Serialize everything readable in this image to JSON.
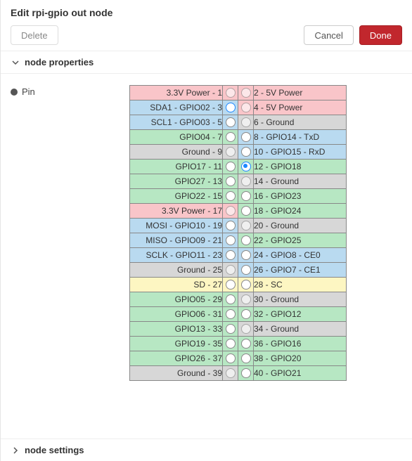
{
  "title": "Edit rpi-gpio out node",
  "buttons": {
    "delete": "Delete",
    "cancel": "Cancel",
    "done": "Done"
  },
  "sections": {
    "properties": "node properties",
    "settings": "node settings"
  },
  "pin_label": "Pin",
  "selected_pin": "12",
  "pins_left": [
    {
      "n": "1",
      "label": "3.3V Power - 1",
      "color": "c-power33",
      "selectable": false
    },
    {
      "n": "3",
      "label": "SDA1 - GPIO02 - 3",
      "color": "c-i2c",
      "selectable": true
    },
    {
      "n": "5",
      "label": "SCL1 - GPIO03 - 5",
      "color": "c-i2c",
      "selectable": true
    },
    {
      "n": "7",
      "label": "GPIO04 - 7",
      "color": "c-gpio",
      "selectable": true
    },
    {
      "n": "9",
      "label": "Ground - 9",
      "color": "c-ground",
      "selectable": false
    },
    {
      "n": "11",
      "label": "GPIO17 - 11",
      "color": "c-gpio",
      "selectable": true
    },
    {
      "n": "13",
      "label": "GPIO27 - 13",
      "color": "c-gpio",
      "selectable": true
    },
    {
      "n": "15",
      "label": "GPIO22 - 15",
      "color": "c-gpio",
      "selectable": true
    },
    {
      "n": "17",
      "label": "3.3V Power - 17",
      "color": "c-power33",
      "selectable": false
    },
    {
      "n": "19",
      "label": "MOSI - GPIO10 - 19",
      "color": "c-spi",
      "selectable": true
    },
    {
      "n": "21",
      "label": "MISO - GPIO09 - 21",
      "color": "c-spi",
      "selectable": true
    },
    {
      "n": "23",
      "label": "SCLK - GPIO11 - 23",
      "color": "c-spi",
      "selectable": true
    },
    {
      "n": "25",
      "label": "Ground - 25",
      "color": "c-ground",
      "selectable": false
    },
    {
      "n": "27",
      "label": "SD - 27",
      "color": "c-sd",
      "selectable": true
    },
    {
      "n": "29",
      "label": "GPIO05 - 29",
      "color": "c-gpio",
      "selectable": true
    },
    {
      "n": "31",
      "label": "GPIO06 - 31",
      "color": "c-gpio",
      "selectable": true
    },
    {
      "n": "33",
      "label": "GPIO13 - 33",
      "color": "c-gpio",
      "selectable": true
    },
    {
      "n": "35",
      "label": "GPIO19 - 35",
      "color": "c-gpio",
      "selectable": true
    },
    {
      "n": "37",
      "label": "GPIO26 - 37",
      "color": "c-gpio",
      "selectable": true
    },
    {
      "n": "39",
      "label": "Ground - 39",
      "color": "c-ground",
      "selectable": false
    }
  ],
  "pins_right": [
    {
      "n": "2",
      "label": "2 - 5V Power",
      "color": "c-power5",
      "selectable": false
    },
    {
      "n": "4",
      "label": "4 - 5V Power",
      "color": "c-power5",
      "selectable": false
    },
    {
      "n": "6",
      "label": "6 - Ground",
      "color": "c-ground",
      "selectable": false
    },
    {
      "n": "8",
      "label": "8 - GPIO14 - TxD",
      "color": "c-uart",
      "selectable": true
    },
    {
      "n": "10",
      "label": "10 - GPIO15 - RxD",
      "color": "c-uart",
      "selectable": true
    },
    {
      "n": "12",
      "label": "12 - GPIO18",
      "color": "c-gpio",
      "selectable": true
    },
    {
      "n": "14",
      "label": "14 - Ground",
      "color": "c-ground",
      "selectable": false
    },
    {
      "n": "16",
      "label": "16 - GPIO23",
      "color": "c-gpio",
      "selectable": true
    },
    {
      "n": "18",
      "label": "18 - GPIO24",
      "color": "c-gpio",
      "selectable": true
    },
    {
      "n": "20",
      "label": "20 - Ground",
      "color": "c-ground",
      "selectable": false
    },
    {
      "n": "22",
      "label": "22 - GPIO25",
      "color": "c-gpio",
      "selectable": true
    },
    {
      "n": "24",
      "label": "24 - GPIO8 - CE0",
      "color": "c-spi",
      "selectable": true
    },
    {
      "n": "26",
      "label": "26 - GPIO7 - CE1",
      "color": "c-spi",
      "selectable": true
    },
    {
      "n": "28",
      "label": "28 - SC",
      "color": "c-sd",
      "selectable": true
    },
    {
      "n": "30",
      "label": "30 - Ground",
      "color": "c-ground",
      "selectable": false
    },
    {
      "n": "32",
      "label": "32 - GPIO12",
      "color": "c-gpio",
      "selectable": true
    },
    {
      "n": "34",
      "label": "34 - Ground",
      "color": "c-ground",
      "selectable": false
    },
    {
      "n": "36",
      "label": "36 - GPIO16",
      "color": "c-gpio",
      "selectable": true
    },
    {
      "n": "38",
      "label": "38 - GPIO20",
      "color": "c-gpio",
      "selectable": true
    },
    {
      "n": "40",
      "label": "40 - GPIO21",
      "color": "c-gpio",
      "selectable": true
    }
  ]
}
